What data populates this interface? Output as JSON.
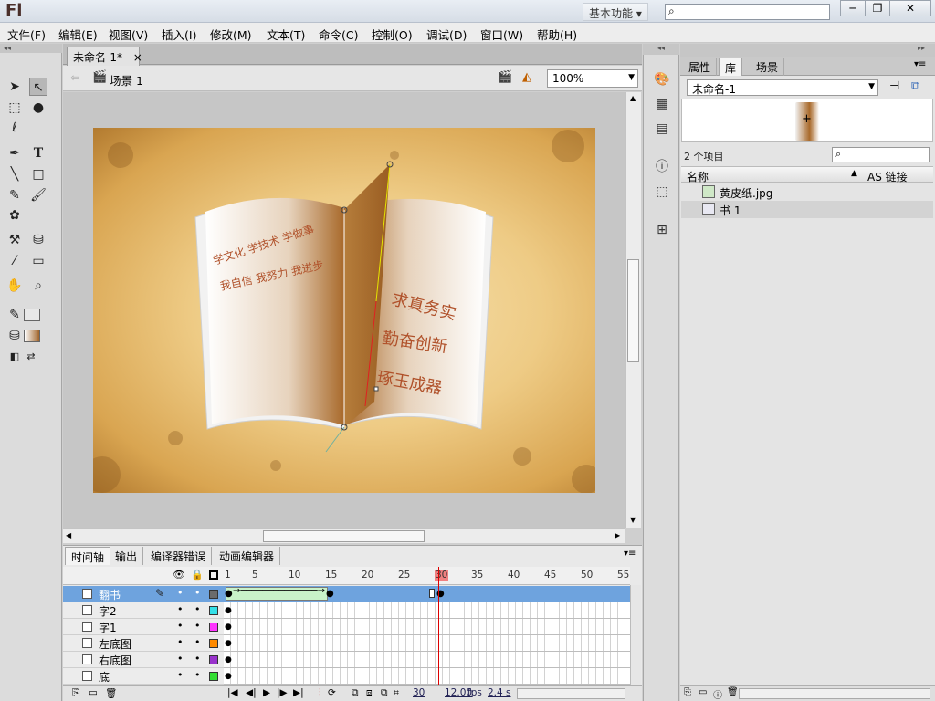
{
  "app": {
    "logo": "Fl",
    "workspace": "基本功能 ▾"
  },
  "window_buttons": [
    "─",
    "❐",
    "✕"
  ],
  "menu": [
    "文件(F)",
    "编辑(E)",
    "视图(V)",
    "插入(I)",
    "修改(M)",
    "文本(T)",
    "命令(C)",
    "控制(O)",
    "调试(D)",
    "窗口(W)",
    "帮助(H)"
  ],
  "document": {
    "tab": "未命名-1*",
    "tab_close": "×",
    "scene": "场景 1",
    "zoom": "100%"
  },
  "stage_text": {
    "left_line1": "学文化  学技术  学做事",
    "left_line2": "我自信  我努力  我进步",
    "right_line1": "求真务实",
    "right_line2": "勤奋创新",
    "right_line3": "琢玉成器"
  },
  "colors": {
    "stage_bg": "#eecb85",
    "page_brown": "#a8692a",
    "text_red": "#b0512a",
    "selected_layer": "#6ea3de"
  },
  "timeline": {
    "tabs": [
      "时间轴",
      "输出",
      "编译器错误",
      "动画编辑器"
    ],
    "frame_numbers": [
      "1",
      "5",
      "10",
      "15",
      "20",
      "25",
      "30",
      "35",
      "40",
      "45",
      "50",
      "55"
    ],
    "layers": [
      {
        "name": "翻书",
        "selected": true,
        "color": "#6b6b6b"
      },
      {
        "name": "字2",
        "selected": false,
        "color": "#35e0e8"
      },
      {
        "name": "字1",
        "selected": false,
        "color": "#ff35ff"
      },
      {
        "name": "左底图",
        "selected": false,
        "color": "#ff8a00"
      },
      {
        "name": "右底图",
        "selected": false,
        "color": "#9933cc"
      },
      {
        "name": "底",
        "selected": false,
        "color": "#33dd33"
      }
    ],
    "status": {
      "frame": "30",
      "fps": "12.00",
      "fps_unit": "fps",
      "time": "2.4 s"
    }
  },
  "library": {
    "tabs": [
      "属性",
      "库",
      "场景"
    ],
    "document": "未命名-1",
    "item_count": "2 个项目",
    "col_name": "名称",
    "col_link": "AS 链接",
    "items": [
      {
        "name": "黄皮纸.jpg",
        "icon": "bitmap-icon"
      },
      {
        "name": "书 1",
        "icon": "graphic-symbol-icon"
      }
    ]
  }
}
